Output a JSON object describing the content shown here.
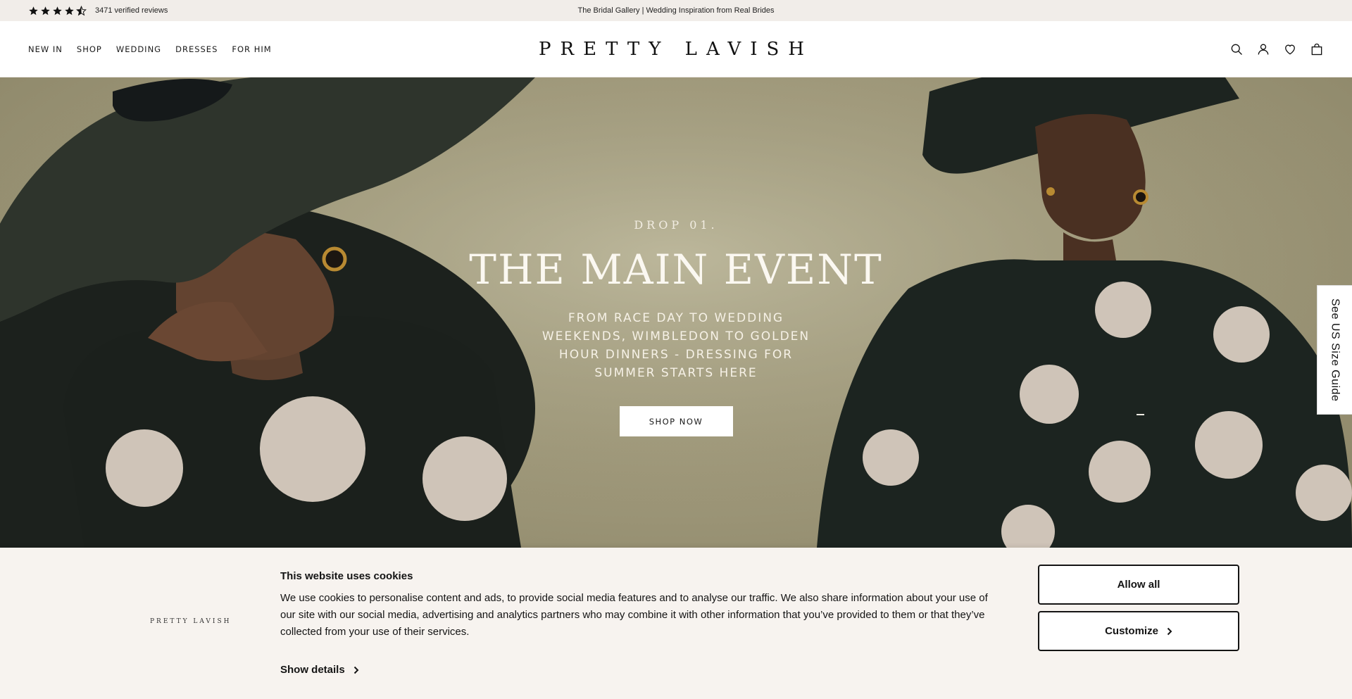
{
  "announcement": {
    "rating_stars": 4.5,
    "reviews_text": "3471 verified reviews",
    "message": "The Bridal Gallery | Wedding Inspiration from Real Brides"
  },
  "header": {
    "nav": [
      "NEW IN",
      "SHOP",
      "WEDDING",
      "DRESSES",
      "FOR HIM"
    ],
    "logo": "PRETTY LAVISH",
    "icons": [
      "search-icon",
      "account-icon",
      "wishlist-heart-icon",
      "shopping-bag-icon"
    ]
  },
  "hero": {
    "eyebrow": "DROP 01.",
    "headline": "THE MAIN EVENT",
    "subline": "FROM RACE DAY TO WEDDING WEEKENDS, WIMBLEDON TO GOLDEN HOUR DINNERS - DRESSING FOR SUMMER STARTS HERE",
    "cta": "SHOP NOW"
  },
  "size_guide": {
    "label": "See US Size Guide"
  },
  "cookie_banner": {
    "logo": "PRETTY LAVISH",
    "title": "This website uses cookies",
    "body": "We use cookies to personalise content and ads, to provide social media features and to analyse our traffic. We also share information about your use of our site with our social media, advertising and analytics partners who may combine it with other information that you’ve provided to them or that they’ve collected from your use of their services.",
    "show_details": "Show details",
    "allow_all": "Allow all",
    "customize": "Customize"
  },
  "colors": {
    "announcement_bg": "#f1ede9",
    "cookie_bg": "#f7f3ef",
    "hero_bg": "#a29b7d",
    "dress_dark": "#1e241f",
    "dot_color": "#cfc4b8"
  }
}
